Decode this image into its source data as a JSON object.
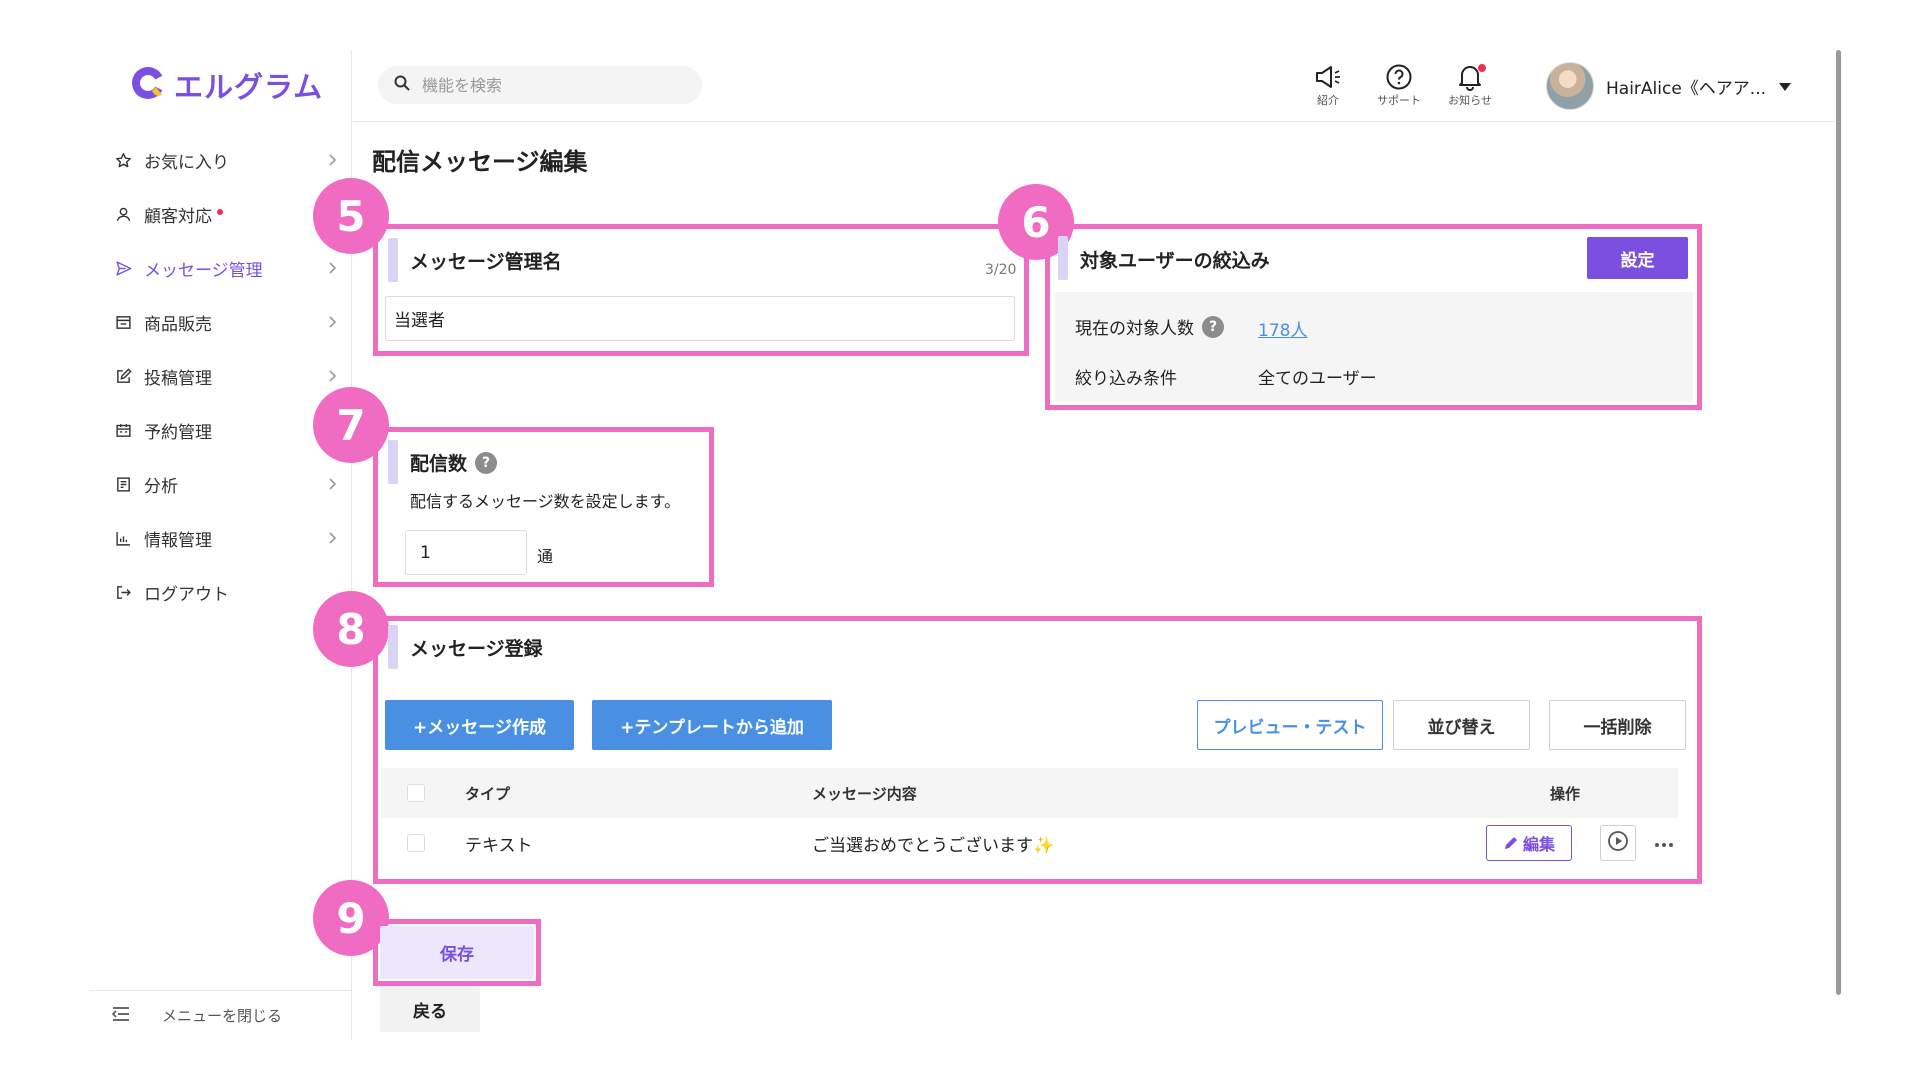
{
  "app": {
    "logo_text": "エルグラム",
    "brand_color": "#7b4fe0"
  },
  "sidebar": {
    "items": [
      {
        "label": "お気に入り",
        "icon": "star-icon",
        "chevron": true
      },
      {
        "label": "顧客対応",
        "icon": "user-icon",
        "chevron": false,
        "dot": true
      },
      {
        "label": "メッセージ管理",
        "icon": "send-icon",
        "chevron": true,
        "active": true
      },
      {
        "label": "商品販売",
        "icon": "store-icon",
        "chevron": true
      },
      {
        "label": "投稿管理",
        "icon": "edit-icon",
        "chevron": true
      },
      {
        "label": "予約管理",
        "icon": "calendar-icon",
        "chevron": false
      },
      {
        "label": "分析",
        "icon": "report-icon",
        "chevron": true
      },
      {
        "label": "情報管理",
        "icon": "chart-icon",
        "chevron": true
      },
      {
        "label": "ログアウト",
        "icon": "logout-icon",
        "chevron": false
      }
    ],
    "close_menu_label": "メニューを閉じる"
  },
  "header": {
    "search_placeholder": "機能を検索",
    "intro_label": "紹介",
    "support_label": "サポート",
    "notice_label": "お知らせ",
    "user_name": "HairAlice《ヘアア..."
  },
  "page": {
    "title": "配信メッセージ編集"
  },
  "annotations": {
    "b5": "5",
    "b6": "6",
    "b7": "7",
    "b8": "8",
    "b9": "9"
  },
  "message_name": {
    "title": "メッセージ管理名",
    "counter": "3/20",
    "value": "当選者"
  },
  "target": {
    "title": "対象ユーザーの絞込み",
    "setting_button": "設定",
    "count_label": "現在の対象人数",
    "count_value": "178人",
    "condition_label": "絞り込み条件",
    "condition_value": "全てのユーザー"
  },
  "delivery": {
    "title": "配信数",
    "description": "配信するメッセージ数を設定します。",
    "value": "1",
    "unit": "通"
  },
  "register": {
    "title": "メッセージ登録",
    "create_button": "+メッセージ作成",
    "template_button": "+テンプレートから追加",
    "preview_button": "プレビュー・テスト",
    "sort_button": "並び替え",
    "bulk_delete_button": "一括削除",
    "col_type": "タイプ",
    "col_content": "メッセージ内容",
    "col_action": "操作",
    "rows": [
      {
        "type": "テキスト",
        "content": "ご当選おめでとうございます✨",
        "edit_label": "編集"
      }
    ]
  },
  "footer": {
    "save_button": "保存",
    "back_button": "戻る"
  }
}
